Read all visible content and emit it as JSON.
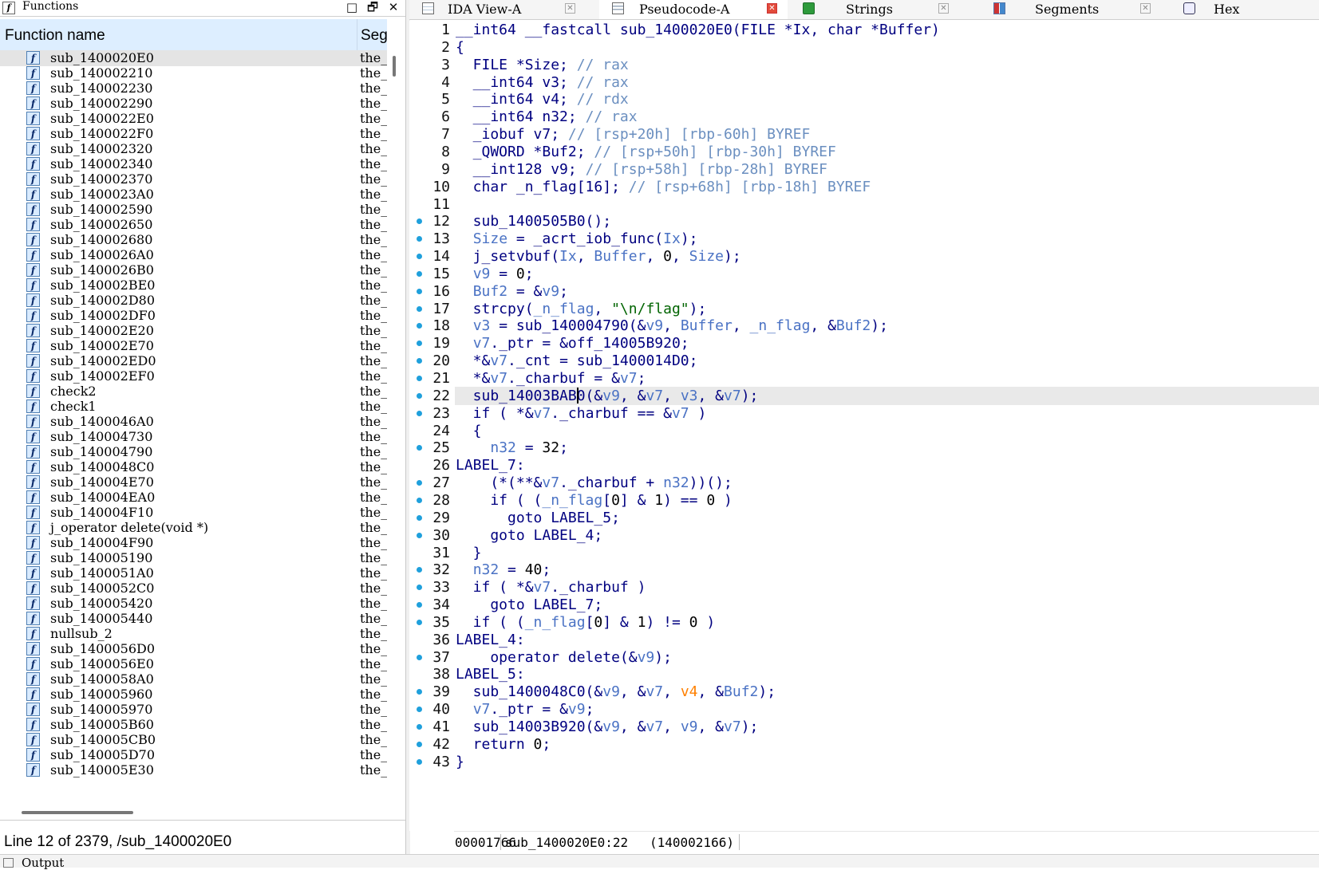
{
  "functions_panel": {
    "title": "Functions",
    "title_icon": "f",
    "window_buttons": [
      "□",
      "🗗",
      "✕"
    ],
    "columns": [
      "Function name",
      "Seg"
    ],
    "selected_index": 0,
    "rows": [
      {
        "name": "sub_1400020E0",
        "seg": "the_"
      },
      {
        "name": "sub_140002210",
        "seg": "the_"
      },
      {
        "name": "sub_140002230",
        "seg": "the_"
      },
      {
        "name": "sub_140002290",
        "seg": "the_"
      },
      {
        "name": "sub_1400022E0",
        "seg": "the_"
      },
      {
        "name": "sub_1400022F0",
        "seg": "the_"
      },
      {
        "name": "sub_140002320",
        "seg": "the_"
      },
      {
        "name": "sub_140002340",
        "seg": "the_"
      },
      {
        "name": "sub_140002370",
        "seg": "the_"
      },
      {
        "name": "sub_1400023A0",
        "seg": "the_"
      },
      {
        "name": "sub_140002590",
        "seg": "the_"
      },
      {
        "name": "sub_140002650",
        "seg": "the_"
      },
      {
        "name": "sub_140002680",
        "seg": "the_"
      },
      {
        "name": "sub_1400026A0",
        "seg": "the_"
      },
      {
        "name": "sub_1400026B0",
        "seg": "the_"
      },
      {
        "name": "sub_140002BE0",
        "seg": "the_"
      },
      {
        "name": "sub_140002D80",
        "seg": "the_"
      },
      {
        "name": "sub_140002DF0",
        "seg": "the_"
      },
      {
        "name": "sub_140002E20",
        "seg": "the_"
      },
      {
        "name": "sub_140002E70",
        "seg": "the_"
      },
      {
        "name": "sub_140002ED0",
        "seg": "the_"
      },
      {
        "name": "sub_140002EF0",
        "seg": "the_"
      },
      {
        "name": "check2",
        "seg": "the_"
      },
      {
        "name": "check1",
        "seg": "the_"
      },
      {
        "name": "sub_1400046A0",
        "seg": "the_"
      },
      {
        "name": "sub_140004730",
        "seg": "the_"
      },
      {
        "name": "sub_140004790",
        "seg": "the_"
      },
      {
        "name": "sub_1400048C0",
        "seg": "the_"
      },
      {
        "name": "sub_140004E70",
        "seg": "the_"
      },
      {
        "name": "sub_140004EA0",
        "seg": "the_"
      },
      {
        "name": "sub_140004F10",
        "seg": "the_"
      },
      {
        "name": "j_operator delete(void *)",
        "seg": "the_"
      },
      {
        "name": "sub_140004F90",
        "seg": "the_"
      },
      {
        "name": "sub_140005190",
        "seg": "the_"
      },
      {
        "name": "sub_1400051A0",
        "seg": "the_"
      },
      {
        "name": "sub_1400052C0",
        "seg": "the_"
      },
      {
        "name": "sub_140005420",
        "seg": "the_"
      },
      {
        "name": "sub_140005440",
        "seg": "the_"
      },
      {
        "name": "nullsub_2",
        "seg": "the_"
      },
      {
        "name": "sub_1400056D0",
        "seg": "the_"
      },
      {
        "name": "sub_1400056E0",
        "seg": "the_"
      },
      {
        "name": "sub_1400058A0",
        "seg": "the_"
      },
      {
        "name": "sub_140005960",
        "seg": "the_"
      },
      {
        "name": "sub_140005970",
        "seg": "the_"
      },
      {
        "name": "sub_140005B60",
        "seg": "the_"
      },
      {
        "name": "sub_140005CB0",
        "seg": "the_"
      },
      {
        "name": "sub_140005D70",
        "seg": "the_"
      },
      {
        "name": "sub_140005E30",
        "seg": "the_"
      }
    ],
    "status": "Line 12 of 2379, /sub_1400020E0"
  },
  "tabs": [
    {
      "label": "IDA View-A",
      "icon": "ida-view-icon",
      "active": false
    },
    {
      "label": "Pseudocode-A",
      "icon": "pseudocode-icon",
      "active": true
    },
    {
      "label": "Strings",
      "icon": "strings-icon",
      "active": false
    },
    {
      "label": "Segments",
      "icon": "segments-icon",
      "active": false
    },
    {
      "label": "Hex",
      "icon": "hex-icon",
      "active": false
    }
  ],
  "tab_close_glyph": "✕",
  "code": {
    "highlight_line": 22,
    "caret": {
      "line": 22,
      "col": 14
    },
    "lines": [
      {
        "n": "1",
        "dot": false,
        "t": [
          [
            "__int64 __fastcall sub_1400020E0(FILE *Ix, char *Buffer)",
            "k"
          ]
        ]
      },
      {
        "n": "2",
        "dot": false,
        "t": [
          [
            "{",
            "k"
          ]
        ]
      },
      {
        "n": "3",
        "dot": false,
        "t": [
          [
            "  FILE *Size; ",
            "k"
          ],
          [
            "// rax",
            "c"
          ]
        ]
      },
      {
        "n": "4",
        "dot": false,
        "t": [
          [
            "  __int64 v3; ",
            "k"
          ],
          [
            "// rax",
            "c"
          ]
        ]
      },
      {
        "n": "5",
        "dot": false,
        "t": [
          [
            "  __int64 v4; ",
            "k"
          ],
          [
            "// rdx",
            "c"
          ]
        ]
      },
      {
        "n": "6",
        "dot": false,
        "t": [
          [
            "  __int64 n32; ",
            "k"
          ],
          [
            "// rax",
            "c"
          ]
        ]
      },
      {
        "n": "7",
        "dot": false,
        "t": [
          [
            "  _iobuf v7; ",
            "k"
          ],
          [
            "// [rsp+20h] [rbp-60h] BYREF",
            "c"
          ]
        ]
      },
      {
        "n": "8",
        "dot": false,
        "t": [
          [
            "  _QWORD *Buf2; ",
            "k"
          ],
          [
            "// [rsp+50h] [rbp-30h] BYREF",
            "c"
          ]
        ]
      },
      {
        "n": "9",
        "dot": false,
        "t": [
          [
            "  __int128 v9; ",
            "k"
          ],
          [
            "// [rsp+58h] [rbp-28h] BYREF",
            "c"
          ]
        ]
      },
      {
        "n": "10",
        "dot": false,
        "t": [
          [
            "  char _n_flag[16]; ",
            "k"
          ],
          [
            "// [rsp+68h] [rbp-18h] BYREF",
            "c"
          ]
        ]
      },
      {
        "n": "11",
        "dot": false,
        "t": []
      },
      {
        "n": "12",
        "dot": true,
        "t": [
          [
            "  sub_1400505B0();",
            "k"
          ]
        ]
      },
      {
        "n": "13",
        "dot": true,
        "t": [
          [
            "  ",
            "k"
          ],
          [
            "Size",
            "v"
          ],
          [
            " = _acrt_iob_func(",
            "k"
          ],
          [
            "Ix",
            "v"
          ],
          [
            ");",
            "k"
          ]
        ]
      },
      {
        "n": "14",
        "dot": true,
        "t": [
          [
            "  j_setvbuf(",
            "k"
          ],
          [
            "Ix",
            "v"
          ],
          [
            ", ",
            "k"
          ],
          [
            "Buffer",
            "v"
          ],
          [
            ", ",
            "k"
          ],
          [
            "0",
            "n"
          ],
          [
            ", ",
            "k"
          ],
          [
            "Size",
            "v"
          ],
          [
            ");",
            "k"
          ]
        ]
      },
      {
        "n": "15",
        "dot": true,
        "t": [
          [
            "  ",
            "k"
          ],
          [
            "v9",
            "v"
          ],
          [
            " = ",
            "k"
          ],
          [
            "0",
            "n"
          ],
          [
            ";",
            "k"
          ]
        ]
      },
      {
        "n": "16",
        "dot": true,
        "t": [
          [
            "  ",
            "k"
          ],
          [
            "Buf2",
            "v"
          ],
          [
            " = &",
            "k"
          ],
          [
            "v9",
            "v"
          ],
          [
            ";",
            "k"
          ]
        ]
      },
      {
        "n": "17",
        "dot": true,
        "t": [
          [
            "  strcpy(",
            "k"
          ],
          [
            "_n_flag",
            "v"
          ],
          [
            ", ",
            "k"
          ],
          [
            "\"\\n/flag\"",
            "s"
          ],
          [
            ");",
            "k"
          ]
        ]
      },
      {
        "n": "18",
        "dot": true,
        "t": [
          [
            "  ",
            "k"
          ],
          [
            "v3",
            "v"
          ],
          [
            " = sub_140004790(&",
            "k"
          ],
          [
            "v9",
            "v"
          ],
          [
            ", ",
            "k"
          ],
          [
            "Buffer",
            "v"
          ],
          [
            ", ",
            "k"
          ],
          [
            "_n_flag",
            "v"
          ],
          [
            ", &",
            "k"
          ],
          [
            "Buf2",
            "v"
          ],
          [
            ");",
            "k"
          ]
        ]
      },
      {
        "n": "19",
        "dot": true,
        "t": [
          [
            "  ",
            "k"
          ],
          [
            "v7",
            "v"
          ],
          [
            "._ptr = &off_14005B920;",
            "k"
          ]
        ]
      },
      {
        "n": "20",
        "dot": true,
        "t": [
          [
            "  *&",
            "k"
          ],
          [
            "v7",
            "v"
          ],
          [
            "._cnt = sub_1400014D0;",
            "k"
          ]
        ]
      },
      {
        "n": "21",
        "dot": true,
        "t": [
          [
            "  *&",
            "k"
          ],
          [
            "v7",
            "v"
          ],
          [
            "._charbuf = &",
            "k"
          ],
          [
            "v7",
            "v"
          ],
          [
            ";",
            "k"
          ]
        ]
      },
      {
        "n": "22",
        "dot": true,
        "t": [
          [
            "  sub_14003BAB0(&",
            "k"
          ],
          [
            "v9",
            "v"
          ],
          [
            ", &",
            "k"
          ],
          [
            "v7",
            "v"
          ],
          [
            ", ",
            "k"
          ],
          [
            "v3",
            "v"
          ],
          [
            ", &",
            "k"
          ],
          [
            "v7",
            "v"
          ],
          [
            ");",
            "k"
          ]
        ]
      },
      {
        "n": "23",
        "dot": true,
        "t": [
          [
            "  if ( *&",
            "k"
          ],
          [
            "v7",
            "v"
          ],
          [
            "._charbuf == &",
            "k"
          ],
          [
            "v7",
            "v"
          ],
          [
            " )",
            "k"
          ]
        ]
      },
      {
        "n": "24",
        "dot": false,
        "t": [
          [
            "  {",
            "k"
          ]
        ]
      },
      {
        "n": "25",
        "dot": true,
        "t": [
          [
            "    ",
            "k"
          ],
          [
            "n32",
            "v"
          ],
          [
            " = ",
            "k"
          ],
          [
            "32",
            "n"
          ],
          [
            ";",
            "k"
          ]
        ]
      },
      {
        "n": "26",
        "dot": false,
        "t": [
          [
            "LABEL_7:",
            "k"
          ]
        ]
      },
      {
        "n": "27",
        "dot": true,
        "t": [
          [
            "    (*(**&",
            "k"
          ],
          [
            "v7",
            "v"
          ],
          [
            "._charbuf + ",
            "k"
          ],
          [
            "n32",
            "v"
          ],
          [
            "))();",
            "k"
          ]
        ]
      },
      {
        "n": "28",
        "dot": true,
        "t": [
          [
            "    if ( (",
            "k"
          ],
          [
            "_n_flag",
            "v"
          ],
          [
            "[",
            "k"
          ],
          [
            "0",
            "n"
          ],
          [
            "] & ",
            "k"
          ],
          [
            "1",
            "n"
          ],
          [
            ") == ",
            "k"
          ],
          [
            "0",
            "n"
          ],
          [
            " )",
            "k"
          ]
        ]
      },
      {
        "n": "29",
        "dot": true,
        "t": [
          [
            "      goto LABEL_5;",
            "k"
          ]
        ]
      },
      {
        "n": "30",
        "dot": true,
        "t": [
          [
            "    goto LABEL_4;",
            "k"
          ]
        ]
      },
      {
        "n": "31",
        "dot": false,
        "t": [
          [
            "  }",
            "k"
          ]
        ]
      },
      {
        "n": "32",
        "dot": true,
        "t": [
          [
            "  ",
            "k"
          ],
          [
            "n32",
            "v"
          ],
          [
            " = ",
            "k"
          ],
          [
            "40",
            "n"
          ],
          [
            ";",
            "k"
          ]
        ]
      },
      {
        "n": "33",
        "dot": true,
        "t": [
          [
            "  if ( *&",
            "k"
          ],
          [
            "v7",
            "v"
          ],
          [
            "._charbuf )",
            "k"
          ]
        ]
      },
      {
        "n": "34",
        "dot": true,
        "t": [
          [
            "    goto LABEL_7;",
            "k"
          ]
        ]
      },
      {
        "n": "35",
        "dot": true,
        "t": [
          [
            "  if ( (",
            "k"
          ],
          [
            "_n_flag",
            "v"
          ],
          [
            "[",
            "k"
          ],
          [
            "0",
            "n"
          ],
          [
            "] & ",
            "k"
          ],
          [
            "1",
            "n"
          ],
          [
            ") != ",
            "k"
          ],
          [
            "0",
            "n"
          ],
          [
            " )",
            "k"
          ]
        ]
      },
      {
        "n": "36",
        "dot": false,
        "t": [
          [
            "LABEL_4:",
            "k"
          ]
        ]
      },
      {
        "n": "37",
        "dot": true,
        "t": [
          [
            "    operator delete(&",
            "k"
          ],
          [
            "v9",
            "v"
          ],
          [
            ");",
            "k"
          ]
        ]
      },
      {
        "n": "38",
        "dot": false,
        "t": [
          [
            "LABEL_5:",
            "k"
          ]
        ]
      },
      {
        "n": "39",
        "dot": true,
        "t": [
          [
            "  sub_1400048C0(&",
            "k"
          ],
          [
            "v9",
            "v"
          ],
          [
            ", &",
            "k"
          ],
          [
            "v7",
            "v"
          ],
          [
            ", ",
            "k"
          ],
          [
            "v4",
            "o"
          ],
          [
            ", &",
            "k"
          ],
          [
            "Buf2",
            "v"
          ],
          [
            ");",
            "k"
          ]
        ]
      },
      {
        "n": "40",
        "dot": true,
        "t": [
          [
            "  ",
            "k"
          ],
          [
            "v7",
            "v"
          ],
          [
            "._ptr = &",
            "k"
          ],
          [
            "v9",
            "v"
          ],
          [
            ";",
            "k"
          ]
        ]
      },
      {
        "n": "41",
        "dot": true,
        "t": [
          [
            "  sub_14003B920(&",
            "k"
          ],
          [
            "v9",
            "v"
          ],
          [
            ", &",
            "k"
          ],
          [
            "v7",
            "v"
          ],
          [
            ", ",
            "k"
          ],
          [
            "v9",
            "v"
          ],
          [
            ", &",
            "k"
          ],
          [
            "v7",
            "v"
          ],
          [
            ");",
            "k"
          ]
        ]
      },
      {
        "n": "42",
        "dot": true,
        "t": [
          [
            "  return ",
            "k"
          ],
          [
            "0",
            "n"
          ],
          [
            ";",
            "k"
          ]
        ]
      },
      {
        "n": "43",
        "dot": true,
        "t": [
          [
            "}",
            "k"
          ]
        ]
      }
    ]
  },
  "code_status": {
    "offset": "00001766",
    "location": "sub_1400020E0:22",
    "address": "(140002166)"
  },
  "output": {
    "label": "Output"
  },
  "colors": {
    "keyword": "#000080",
    "comment": "#6b8fc0",
    "variable": "#4a72c4",
    "string": "#006400",
    "number": "#000000",
    "highlight_var": "#ff8000",
    "breakpoint_dot": "#1fa0dc",
    "header_bg": "#ddeeff",
    "selected_row": "#e4e4e4",
    "current_line": "#e9e9e9",
    "active_tab_close": "#e24b3b"
  }
}
